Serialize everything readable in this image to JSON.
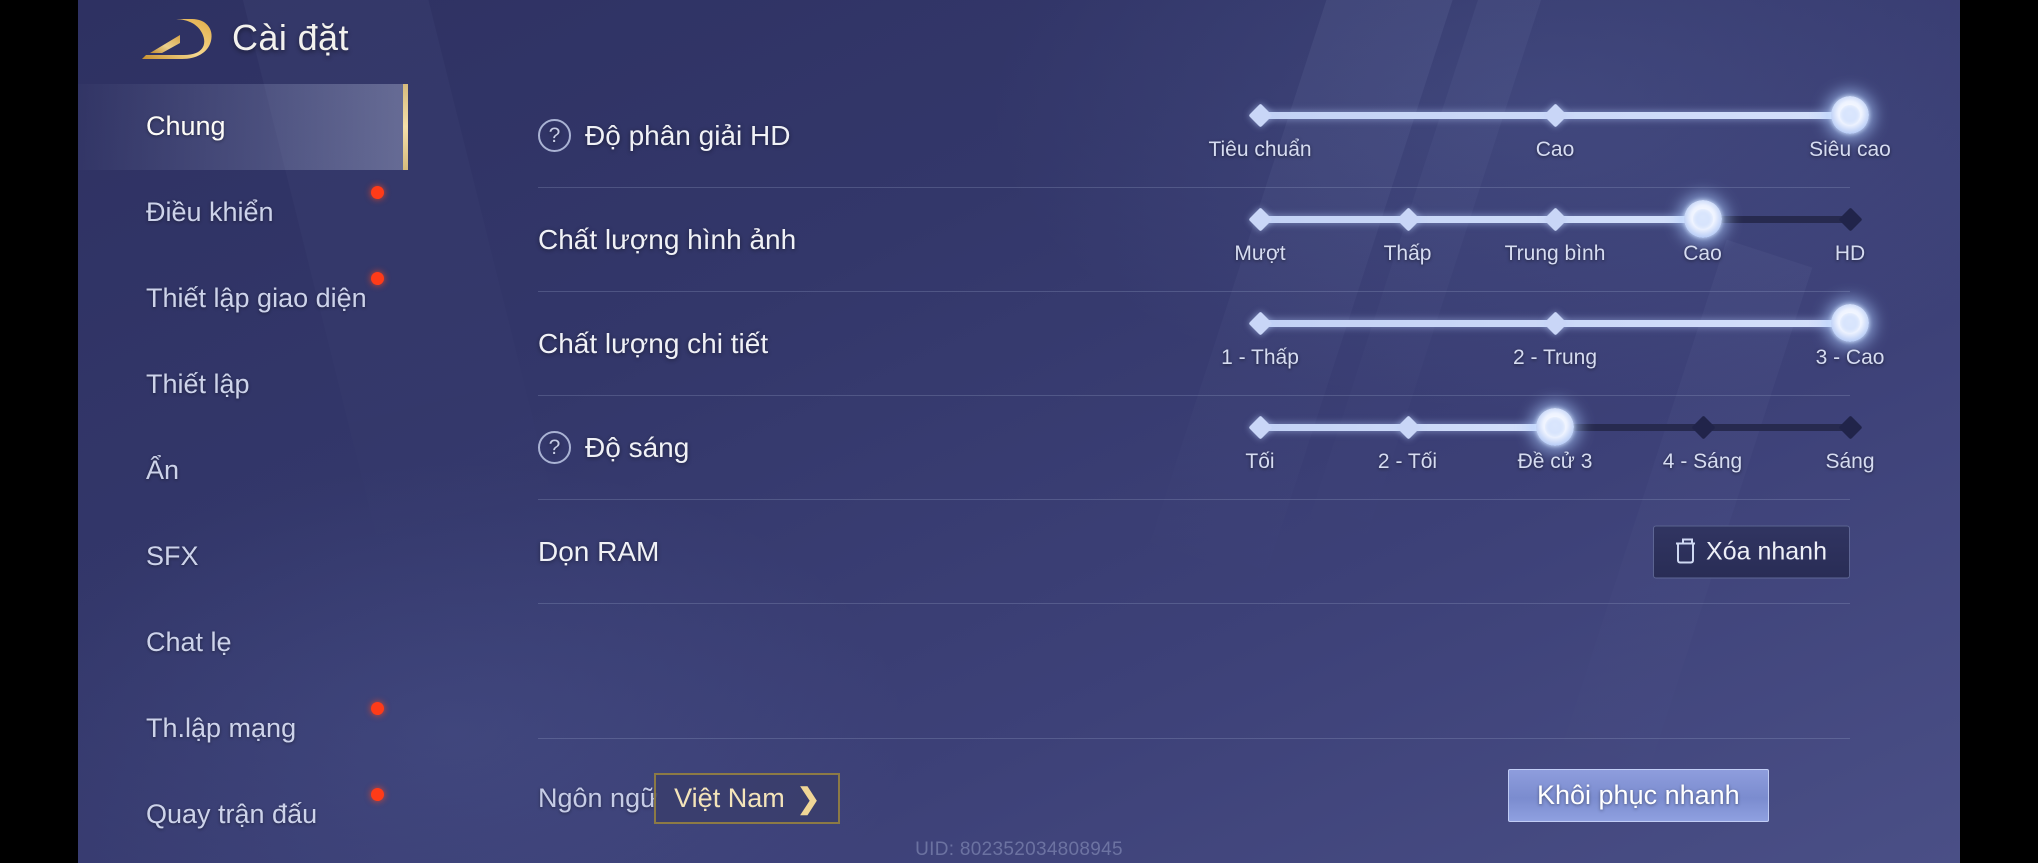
{
  "header": {
    "title": "Cài đặt",
    "logo_icon": "gold-swoosh-logo"
  },
  "sidebar": {
    "items": [
      {
        "label": "Chung",
        "active": true,
        "badge": false
      },
      {
        "label": "Điều khiển",
        "active": false,
        "badge": true
      },
      {
        "label": "Thiết lập giao diện",
        "active": false,
        "badge": true
      },
      {
        "label": "Thiết lập",
        "active": false,
        "badge": false
      },
      {
        "label": "Ẩn",
        "active": false,
        "badge": false
      },
      {
        "label": "SFX",
        "active": false,
        "badge": false
      },
      {
        "label": "Chat lẹ",
        "active": false,
        "badge": false
      },
      {
        "label": "Th.lập mạng",
        "active": false,
        "badge": true
      },
      {
        "label": "Quay trận đấu",
        "active": false,
        "badge": true
      }
    ]
  },
  "settings": {
    "rows": [
      {
        "label": "Độ phân giải HD",
        "help_icon": "question-mark-icon",
        "has_help": true,
        "type": "slider",
        "options": [
          "Tiêu chuẩn",
          "Cao",
          "Siêu cao"
        ],
        "value_index": 2,
        "value": "Siêu cao"
      },
      {
        "label": "Chất lượng hình ảnh",
        "has_help": false,
        "type": "slider",
        "options": [
          "Mượt",
          "Thấp",
          "Trung bình",
          "Cao",
          "HD"
        ],
        "value_index": 3,
        "value": "Cao"
      },
      {
        "label": "Chất lượng chi tiết",
        "has_help": false,
        "type": "slider",
        "options": [
          "1 - Thấp",
          "2 - Trung",
          "3 - Cao"
        ],
        "value_index": 2,
        "value": "3 - Cao"
      },
      {
        "label": "Độ sáng",
        "help_icon": "question-mark-icon",
        "has_help": true,
        "type": "slider",
        "options": [
          "Tối",
          "2 - Tối",
          "Đề cử 3",
          "4 - Sáng",
          "Sáng"
        ],
        "value_index": 2,
        "value": "Đề cử 3"
      },
      {
        "label": "Dọn RAM",
        "has_help": false,
        "type": "button",
        "button_label": "Xóa nhanh",
        "button_icon": "trash-icon"
      }
    ]
  },
  "footer": {
    "language_label": "Ngôn ngữ",
    "language_value": "Việt Nam",
    "language_chevron": "chevron-right-icon",
    "restore_label": "Khôi phục nhanh",
    "uid": "UID: 802352034808945"
  },
  "colors": {
    "accent_gold": "#f0d696",
    "badge_red": "#ff3b18",
    "slider_fill": "#c9d6f7",
    "panel_bg": "#3d4178"
  }
}
